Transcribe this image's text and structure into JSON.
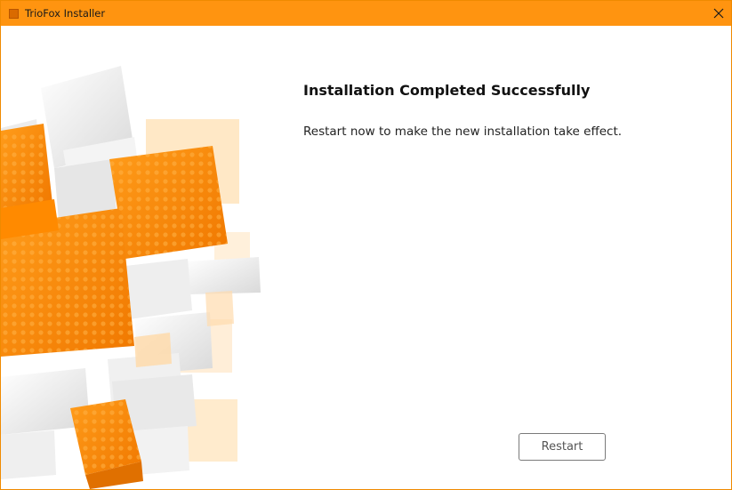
{
  "window": {
    "title": "TrioFox Installer",
    "accent_color": "#ff9410"
  },
  "content": {
    "heading": "Installation Completed Successfully",
    "message": "Restart now to make the new installation take effect."
  },
  "actions": {
    "restart_label": "Restart"
  },
  "icons": {
    "app": "app-icon",
    "close": "close-icon"
  }
}
